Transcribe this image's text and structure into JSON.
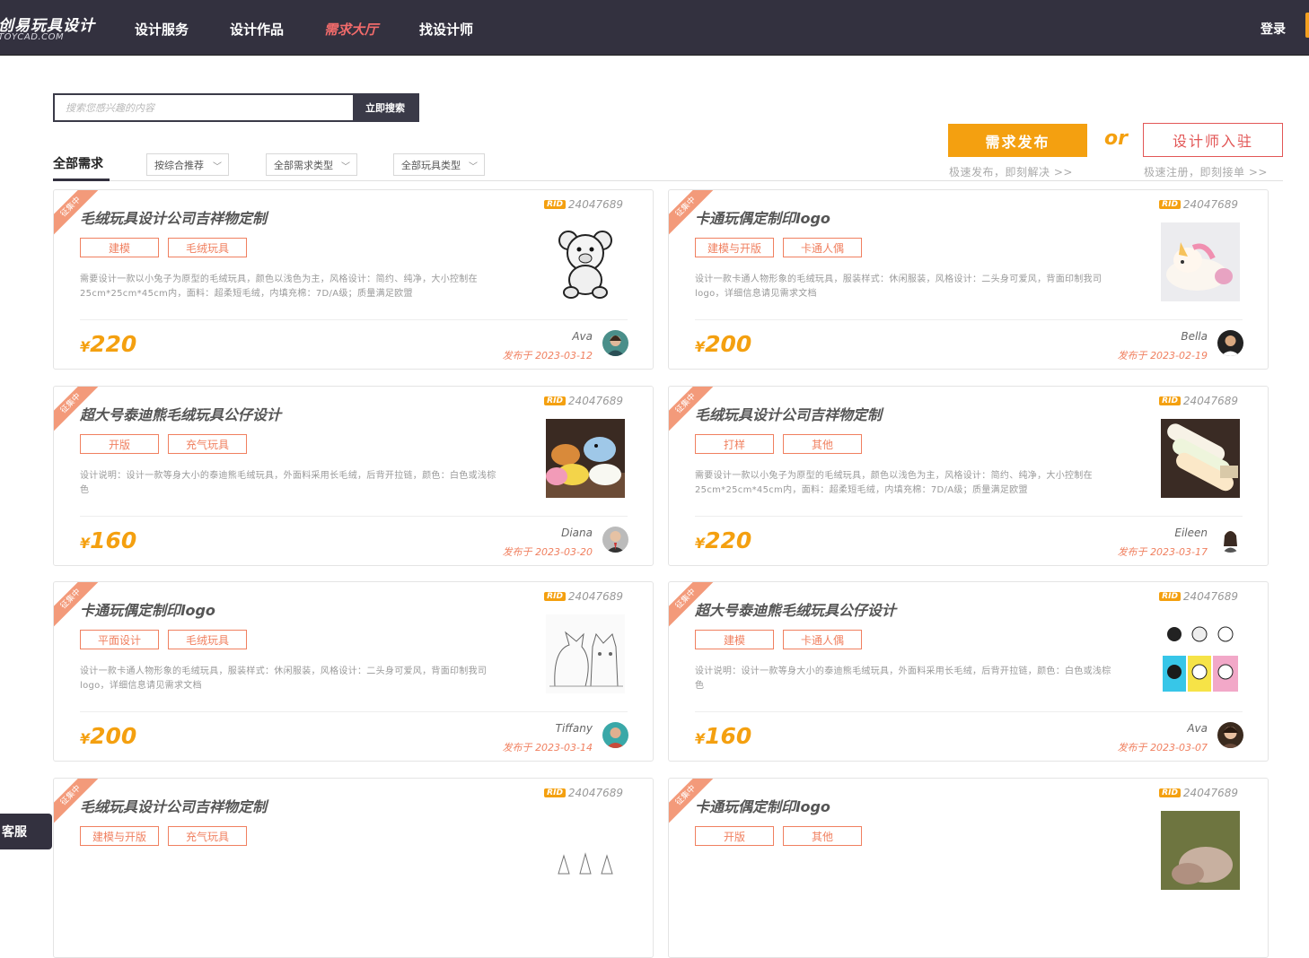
{
  "nav": {
    "logo_main": "创易玩具设计",
    "logo_sub": "TOYCAD.COM",
    "items": [
      {
        "label": "设计服务"
      },
      {
        "label": "设计作品"
      },
      {
        "label": "需求大厅"
      },
      {
        "label": "找设计师"
      }
    ],
    "active_index": 2,
    "login": "登录"
  },
  "search": {
    "placeholder": "搜索您感兴趣的内容",
    "button": "立即搜索"
  },
  "cta": {
    "publish": "需求发布",
    "or": "or",
    "designer": "设计师入驻",
    "publish_sub": "极速发布，即刻解决 >>",
    "designer_sub": "极速注册，即刻接单 >>"
  },
  "filters": {
    "tab": "全部需求",
    "sort": "按综合推荐",
    "demand_type": "全部需求类型",
    "toy_type": "全部玩具类型"
  },
  "ribbon": "征集中",
  "rid_tag": "RID",
  "date_prefix": "发布于",
  "currency": "¥",
  "cards": [
    {
      "rid": "24047689",
      "title": "毛绒玩具设计公司吉祥物定制",
      "tags": [
        "建模",
        "毛绒玩具"
      ],
      "desc": "需要设计一款以小兔子为原型的毛绒玩具，颜色以浅色为主，风格设计：简约、纯净，大小控制在25cm*25cm*45cm内，面料：超柔短毛绒，内填充棉：7D/A级；质量满足欧盟",
      "price": "220",
      "author": "Ava",
      "date": "2023-03-12",
      "thumb": "bear-sketch",
      "avatar": "avatar-1"
    },
    {
      "rid": "24047689",
      "title": "卡通玩偶定制印logo",
      "tags": [
        "建模与开版",
        "卡通人偶"
      ],
      "desc": "设计一款卡通人物形象的毛绒玩具，服装样式：休闲服装，风格设计：二头身可爱风，背面印制我司logo，详细信息请见需求文档",
      "price": "200",
      "author": "Bella",
      "date": "2023-02-19",
      "thumb": "unicorn-plush",
      "avatar": "avatar-2"
    },
    {
      "rid": "24047689",
      "title": "超大号泰迪熊毛绒玩具公仔设计",
      "tags": [
        "开版",
        "充气玩具"
      ],
      "desc": "设计说明：设计一款等身大小的泰迪熊毛绒玩具，外面料采用长毛绒，后背开拉链，颜色：白色或浅棕色",
      "price": "160",
      "author": "Diana",
      "date": "2023-03-20",
      "thumb": "dino-plush",
      "avatar": "avatar-3"
    },
    {
      "rid": "24047689",
      "title": "毛绒玩具设计公司吉祥物定制",
      "tags": [
        "打样",
        "其他"
      ],
      "desc": "需要设计一款以小兔子为原型的毛绒玩具，颜色以浅色为主，风格设计：简约、纯净，大小控制在25cm*25cm*45cm内，面料：超柔短毛绒，内填充棉：7D/A级；质量满足欧盟",
      "price": "220",
      "author": "Eileen",
      "date": "2023-03-17",
      "thumb": "pillow-plush",
      "avatar": "avatar-4"
    },
    {
      "rid": "24047689",
      "title": "卡通玩偶定制印logo",
      "tags": [
        "平面设计",
        "毛绒玩具"
      ],
      "desc": "设计一款卡通人物形象的毛绒玩具，服装样式：休闲服装，风格设计：二头身可爱风，背面印制我司logo，详细信息请见需求文档",
      "price": "200",
      "author": "Tiffany",
      "date": "2023-03-14",
      "thumb": "cat-sketch",
      "avatar": "avatar-5"
    },
    {
      "rid": "24047689",
      "title": "超大号泰迪熊毛绒玩具公仔设计",
      "tags": [
        "建模",
        "卡通人偶"
      ],
      "desc": "设计说明：设计一款等身大小的泰迪熊毛绒玩具，外面料采用长毛绒，后背开拉链，颜色：白色或浅棕色",
      "price": "160",
      "author": "Ava",
      "date": "2023-03-07",
      "thumb": "bunny-grid",
      "avatar": "avatar-6"
    },
    {
      "rid": "24047689",
      "title": "毛绒玩具设计公司吉祥物定制",
      "tags": [
        "建模与开版",
        "充气玩具"
      ],
      "desc": "",
      "price": "",
      "author": "",
      "date": "",
      "thumb": "sketch-partial",
      "avatar": ""
    },
    {
      "rid": "24047689",
      "title": "卡通玩偶定制印logo",
      "tags": [
        "开版",
        "其他"
      ],
      "desc": "",
      "price": "",
      "author": "",
      "date": "",
      "thumb": "photo-partial",
      "avatar": ""
    }
  ],
  "service": "客服",
  "colors": {
    "accent": "#f4a010",
    "nav_bg": "#33313f",
    "tag": "#f08060",
    "active_nav": "#f26b6b"
  }
}
